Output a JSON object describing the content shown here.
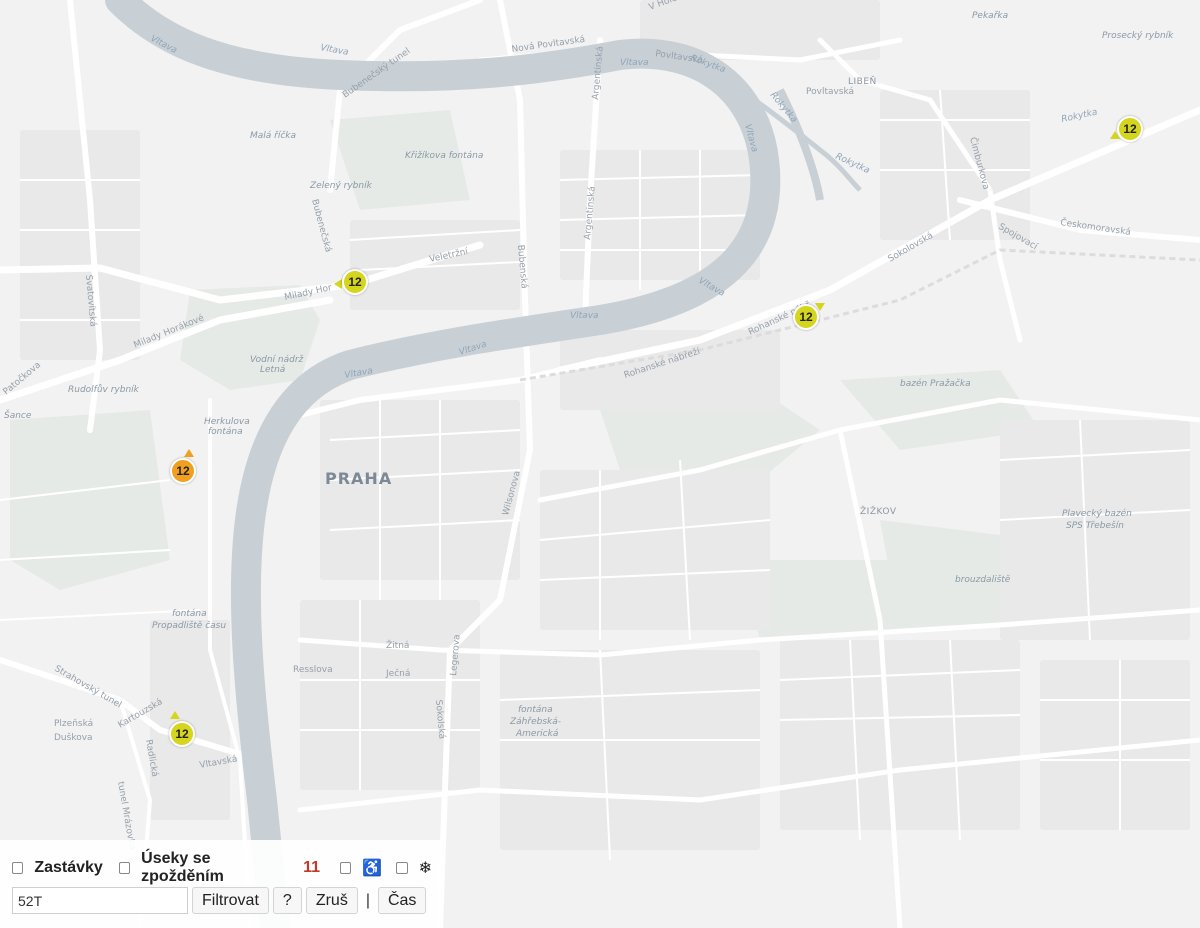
{
  "map": {
    "city_label": "PRAHA",
    "district_labels": [
      {
        "id": "liben",
        "text": "LIBEŇ"
      },
      {
        "id": "zizkov",
        "text": "ŽIŽKOV"
      }
    ],
    "water_labels": [
      {
        "id": "vltava-1",
        "text": "Vltava"
      },
      {
        "id": "vltava-2",
        "text": "Vltava"
      },
      {
        "id": "vltava-3",
        "text": "Vltava"
      },
      {
        "id": "vltava-4",
        "text": "Vltava"
      },
      {
        "id": "vltava-5",
        "text": "Vltava"
      },
      {
        "id": "vltava-6",
        "text": "Vltava"
      },
      {
        "id": "vltava-7",
        "text": "Vltava"
      },
      {
        "id": "vltava-8",
        "text": "Vltava"
      },
      {
        "id": "rokytka-1",
        "text": "Rokytka"
      },
      {
        "id": "rokytka-2",
        "text": "Rokytka"
      },
      {
        "id": "rokytka-3",
        "text": "Rokytka"
      },
      {
        "id": "rokytka-4",
        "text": "Rokytka"
      },
      {
        "id": "vodni-nadrz",
        "text": "Vodní nádrž"
      },
      {
        "id": "letna",
        "text": "Letná"
      }
    ],
    "place_labels": [
      {
        "id": "mala-ricka",
        "text": "Malá říčka"
      },
      {
        "id": "krizikova-fontana",
        "text": "Křižíkova fontána"
      },
      {
        "id": "zeleny-rybnik",
        "text": "Zelený rybník"
      },
      {
        "id": "rudolfuv-rybnik",
        "text": "Rudolfův rybník"
      },
      {
        "id": "herkulova",
        "text": "Herkulova"
      },
      {
        "id": "fontana-1",
        "text": "fontána"
      },
      {
        "id": "fontana-2",
        "text": "fontána"
      },
      {
        "id": "propadliste",
        "text": "Propadliště času"
      },
      {
        "id": "fontana-3",
        "text": "fontána"
      },
      {
        "id": "zahrebska",
        "text": "Záhřebská-"
      },
      {
        "id": "americka",
        "text": "Americká"
      },
      {
        "id": "bazen-prazacka",
        "text": "bazén Pražačka"
      },
      {
        "id": "plavecky-bazen",
        "text": "Plavecký bazén"
      },
      {
        "id": "sps-trebesin",
        "text": "SPS Třebešín"
      },
      {
        "id": "brouzdaliste",
        "text": "brouzdaliště"
      },
      {
        "id": "pekarka",
        "text": "Pekařka"
      },
      {
        "id": "prosecky-rybnik",
        "text": "Prosecký rybník"
      },
      {
        "id": "sance",
        "text": "Šance"
      }
    ],
    "road_labels": [
      {
        "id": "nova-povltavska",
        "text": "Nová Povltavská"
      },
      {
        "id": "povltavska-1",
        "text": "Povltavská"
      },
      {
        "id": "povltavska-2",
        "text": "Povltavská"
      },
      {
        "id": "bubenecsky-tunel",
        "text": "Bubenečský tunel"
      },
      {
        "id": "bubenecska",
        "text": "Bubenečská"
      },
      {
        "id": "argentinska-1",
        "text": "Argentinská"
      },
      {
        "id": "argentinska-2",
        "text": "Argentinská"
      },
      {
        "id": "veletrzni",
        "text": "Veletržní"
      },
      {
        "id": "milady-horakove-1",
        "text": "Milady Hor"
      },
      {
        "id": "milady-horakove-2",
        "text": "Milady Horákové"
      },
      {
        "id": "bubenska",
        "text": "Bubenská"
      },
      {
        "id": "svatovitska",
        "text": "Svatovítská"
      },
      {
        "id": "patockova",
        "text": "Patočkova"
      },
      {
        "id": "rohanske-1",
        "text": "Rohanské nábř."
      },
      {
        "id": "rohanske-2",
        "text": "Rohanské nábřeží"
      },
      {
        "id": "sokolovska",
        "text": "Sokolovská"
      },
      {
        "id": "ceskomoravska",
        "text": "Českomoravská"
      },
      {
        "id": "spojovaci",
        "text": "Spojovací"
      },
      {
        "id": "cimburkova",
        "text": "Čimburkova"
      },
      {
        "id": "wilsonova",
        "text": "Wilsonova"
      },
      {
        "id": "zitna",
        "text": "Žitná"
      },
      {
        "id": "jecna",
        "text": "Ječná"
      },
      {
        "id": "resslova",
        "text": "Resslova"
      },
      {
        "id": "legerova",
        "text": "Legerova"
      },
      {
        "id": "sokolska",
        "text": "Sokolská"
      },
      {
        "id": "strahovsky-tunel",
        "text": "Strahovský tunel"
      },
      {
        "id": "plzenska",
        "text": "Plzeňská"
      },
      {
        "id": "duskova",
        "text": "Duškova"
      },
      {
        "id": "kartouzska",
        "text": "Kartouzská"
      },
      {
        "id": "radlicka",
        "text": "Radlická"
      },
      {
        "id": "vltavska",
        "text": "Vltavská"
      },
      {
        "id": "tunel-mrazovka",
        "text": "tunel Mrázovka"
      },
      {
        "id": "v-holesovickach",
        "text": "V Holešovičkách"
      }
    ],
    "vehicle_markers": [
      {
        "id": "vehicle-1",
        "label": "12",
        "color": "#d4d51c"
      },
      {
        "id": "vehicle-2",
        "label": "12",
        "color": "#d4d51c"
      },
      {
        "id": "vehicle-3",
        "label": "12",
        "color": "#d4d51c"
      },
      {
        "id": "vehicle-4",
        "label": "12",
        "color": "#f0a01e"
      },
      {
        "id": "vehicle-5",
        "label": "12",
        "color": "#d4d51c"
      }
    ]
  },
  "controls": {
    "stops_label": "Zastávky",
    "delayed_label": "Úseky se zpožděním",
    "delayed_count": "11",
    "wheelchair_icon_glyph": "♿",
    "snowflake_icon_glyph": "❄",
    "filter_value": "52T",
    "filter_button": "Filtrovat",
    "help_button": "?",
    "cancel_button": "Zruš",
    "separator": "|",
    "time_button": "Čas"
  },
  "colors": {
    "land": "#f2f2f2",
    "block": "#e8e8e8",
    "water": "#c8d0d6",
    "road": "#ffffff",
    "park": "#e4e9e4",
    "count": "#c0392b"
  }
}
